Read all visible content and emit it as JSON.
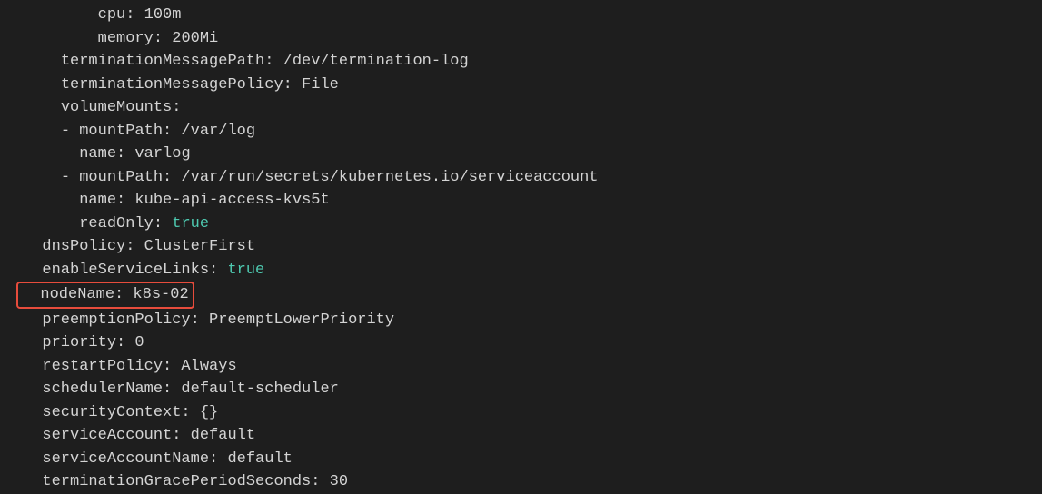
{
  "lines": {
    "cpu_key": "cpu:",
    "cpu_val": " 100m",
    "memory_key": "memory:",
    "memory_val": " 200Mi",
    "termMsgPath_key": "terminationMessagePath:",
    "termMsgPath_val": " /dev/termination-log",
    "termMsgPolicy_key": "terminationMessagePolicy:",
    "termMsgPolicy_val": " File",
    "volumeMounts_key": "volumeMounts:",
    "mount1_key": "- mountPath:",
    "mount1_val": " /var/log",
    "mount1_name_key": "name:",
    "mount1_name_val": " varlog",
    "mount2_key": "- mountPath:",
    "mount2_val": " /var/run/secrets/kubernetes.io/serviceaccount",
    "mount2_name_key": "name:",
    "mount2_name_val": " kube-api-access-kvs5t",
    "readOnly_key": "readOnly:",
    "readOnly_val": " true",
    "dnsPolicy_key": "dnsPolicy:",
    "dnsPolicy_val": " ClusterFirst",
    "enableSvcLinks_key": "enableServiceLinks:",
    "enableSvcLinks_val": " true",
    "nodeName_key": "nodeName:",
    "nodeName_val": " k8s-02",
    "preemptPolicy_key": "preemptionPolicy:",
    "preemptPolicy_val": " PreemptLowerPriority",
    "priority_key": "priority:",
    "priority_val": " 0",
    "restartPolicy_key": "restartPolicy:",
    "restartPolicy_val": " Always",
    "schedulerName_key": "schedulerName:",
    "schedulerName_val": " default-scheduler",
    "securityContext_key": "securityContext:",
    "securityContext_val": " {}",
    "serviceAccount_key": "serviceAccount:",
    "serviceAccount_val": " default",
    "serviceAccountName_key": "serviceAccountName:",
    "serviceAccountName_val": " default",
    "termGrace_key": "terminationGracePeriodSeconds:",
    "termGrace_val": " 30"
  },
  "indent": {
    "s8": "        ",
    "s6": "      ",
    "s4": "    ",
    "s2": "  ",
    "s0": ""
  }
}
